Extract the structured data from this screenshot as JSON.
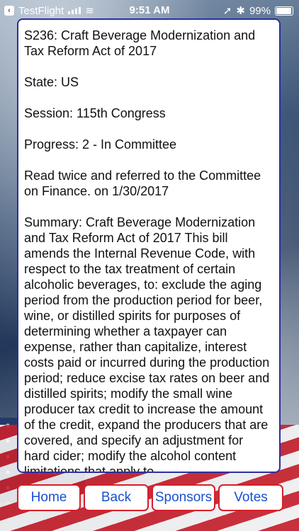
{
  "status_bar": {
    "carrier": "TestFlight",
    "time": "9:51 AM",
    "battery": "99%"
  },
  "bill": {
    "title": "S236: Craft Beverage Modernization and Tax Reform Act of 2017",
    "state": "State: US",
    "session": "Session: 115th Congress",
    "progress": "Progress: 2 - In Committee",
    "last_action": "Read twice and referred to the Committee on Finance. on 1/30/2017",
    "summary": "Summary: Craft Beverage Modernization and Tax Reform Act of 2017 This bill amends the Internal Revenue Code, with respect to the tax treatment of certain alcoholic beverages, to: exclude the aging period from the production period for beer, wine, or distilled spirits for purposes of determining whether a taxpayer can expense, rather than capitalize, interest costs paid or incurred during the production period; reduce excise tax rates on beer and distilled spirits; modify the small wine producer tax credit to increase the amount of the credit, expand the producers that are covered, and specify an adjustment for hard cider; modify the alcohol content limitations that apply to"
  },
  "buttons": {
    "home": "Home",
    "back": "Back",
    "sponsors": "Sponsors",
    "votes": "Votes"
  },
  "colors": {
    "card_border": "#2b2f9f",
    "button_border": "#d61f2b",
    "button_text": "#1a4fd1"
  }
}
